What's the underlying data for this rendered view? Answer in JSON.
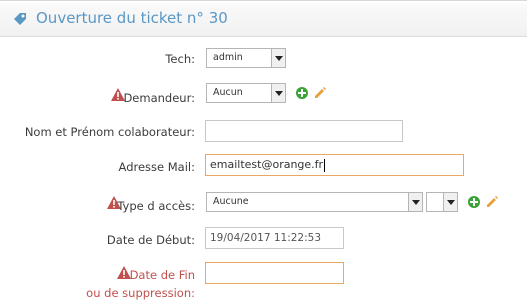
{
  "header": {
    "title": "Ouverture du ticket n° 30",
    "icon": "tag-icon"
  },
  "form": {
    "tech": {
      "label": "Tech:",
      "value": "admin"
    },
    "demandeur": {
      "label": "Demandeur:",
      "value": "Aucun"
    },
    "nom": {
      "label": "Nom et Prénom colaborateur:",
      "value": ""
    },
    "mail": {
      "label": "Adresse Mail:",
      "value": "emailtest@orange.fr"
    },
    "type_acces": {
      "label": "Type d accès:",
      "value": "Aucune",
      "secondary_value": ""
    },
    "date_debut": {
      "label": "Date de Début:",
      "value": "19/04/2017 11:22:53"
    },
    "date_fin": {
      "label_line1": "Date de Fin",
      "label_line2": "ou de suppression:",
      "value": ""
    }
  },
  "colors": {
    "title": "#5a97c4",
    "required": "#c0504d",
    "add": "#3aa335",
    "edit": "#e8a03a",
    "focus_border": "#e8a765"
  }
}
